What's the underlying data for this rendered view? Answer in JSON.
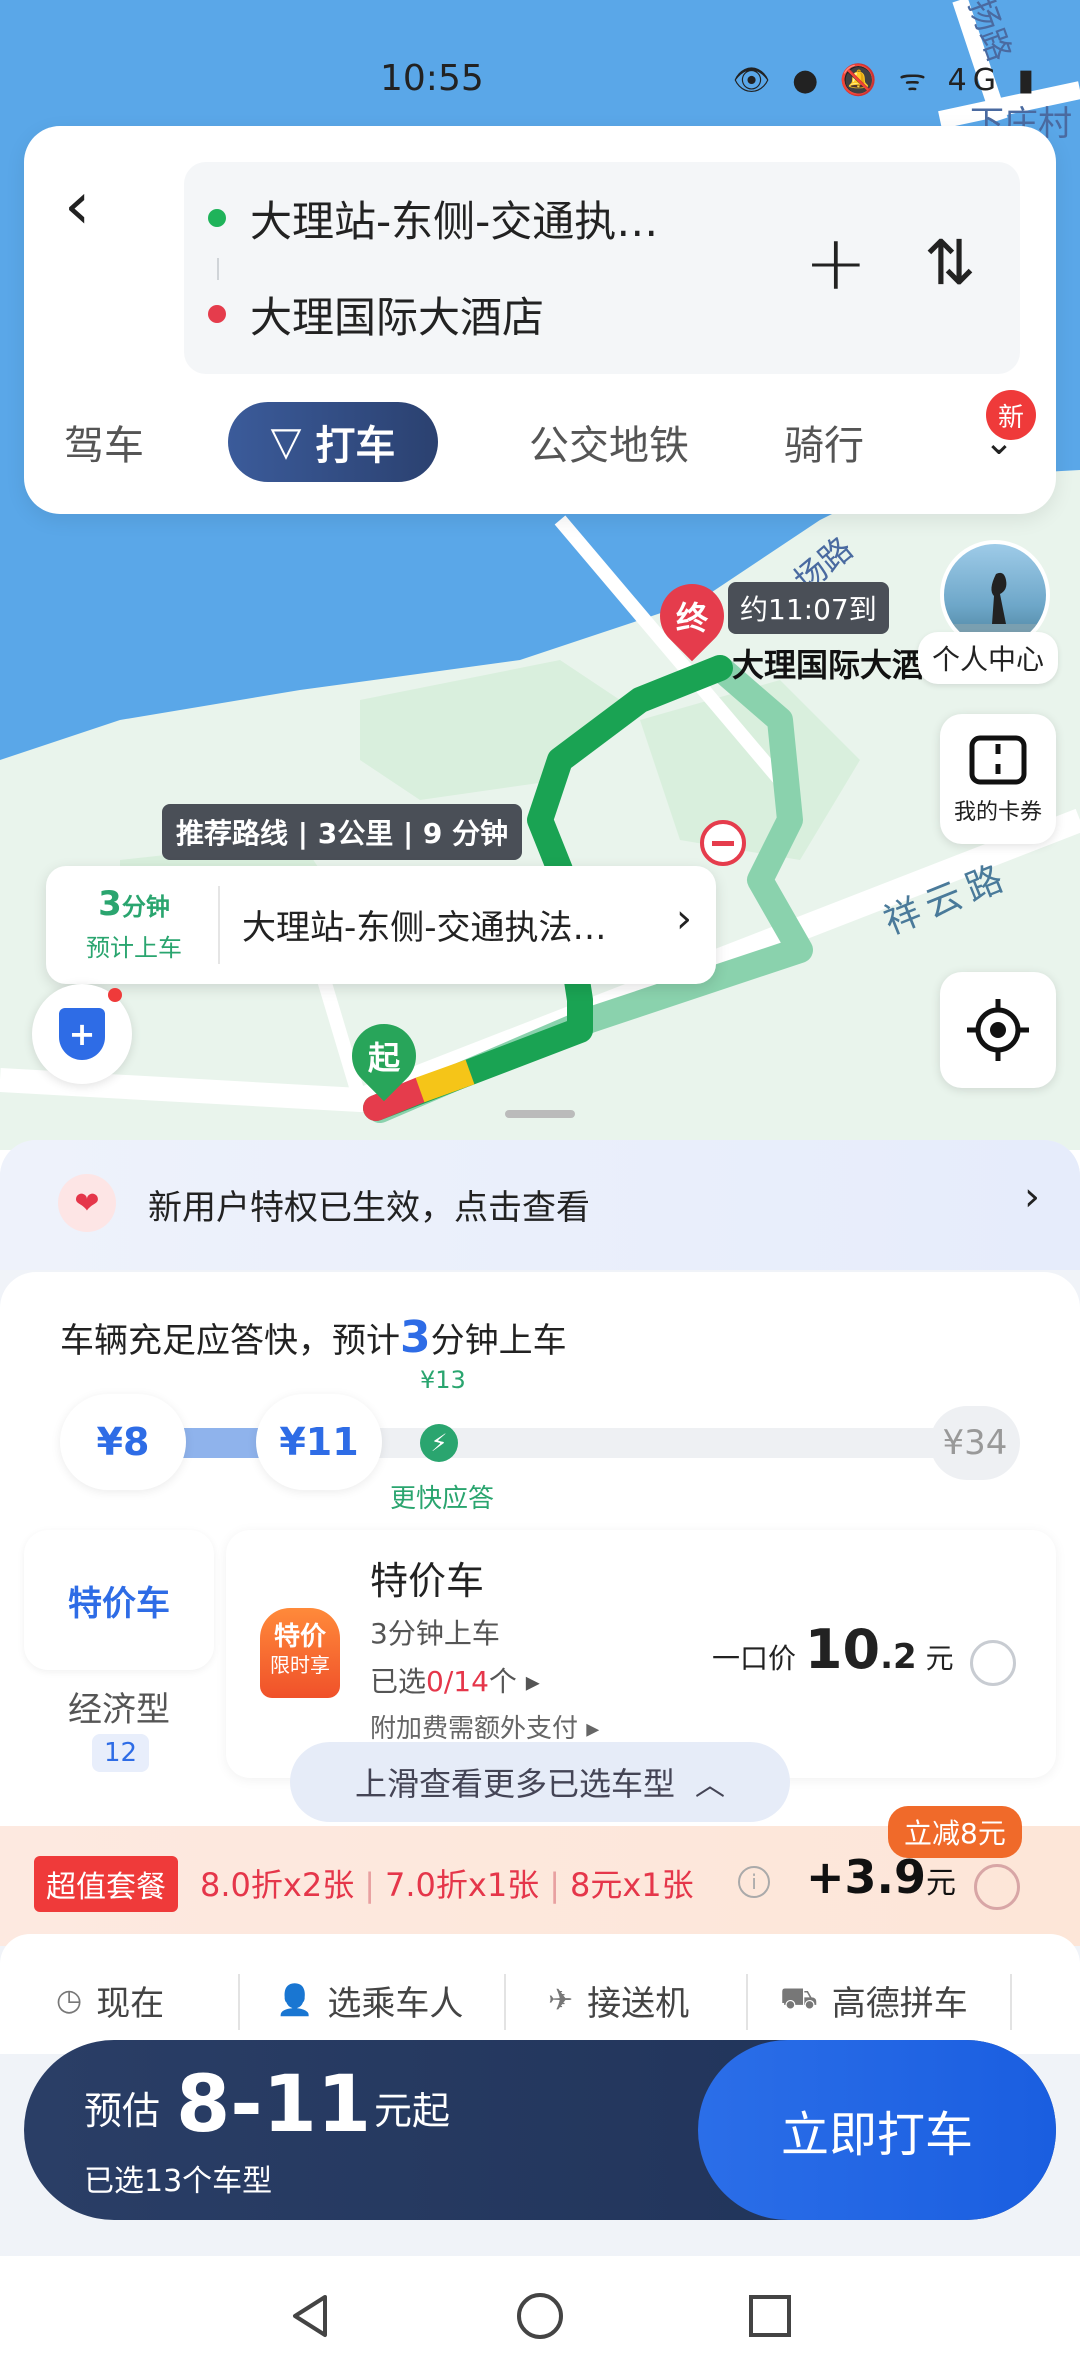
{
  "status": {
    "time": "10:55",
    "icons": "👁 ● 🔕 ᯤ 4G ▮"
  },
  "map": {
    "labels": {
      "xiazhuang": "下庄村",
      "road_top": "扬路",
      "xiangyun_road": "祥云路",
      "road_mid": "场路"
    },
    "eta_tag": "约11:07到",
    "dest_name": "大理国际大酒",
    "end_pin": "终",
    "start_pin": "起",
    "recommend_tag": "推荐路线 | 3公里 | 9 分钟",
    "personal_center": "个人中心",
    "coupons": "我的卡券",
    "pickup": {
      "mins": "3",
      "mins_unit": "分钟",
      "sub": "预计上车",
      "address": "大理站-东侧-交通执法…"
    }
  },
  "route": {
    "start": "大理站-东侧-交通执…",
    "end": "大理国际大酒店",
    "add_icon": "+",
    "swap_icon": "⇅"
  },
  "tabs": [
    {
      "label": "驾车"
    },
    {
      "label": "打车"
    },
    {
      "label": "公交地铁"
    },
    {
      "label": "骑行"
    }
  ],
  "new_badge": "新",
  "promo": {
    "text": "新用户特权已生效，点击查看"
  },
  "supply": {
    "prefix": "车辆充足应答快，预计",
    "num": "3",
    "suffix": "分钟上车"
  },
  "price_slider": {
    "low": "¥8",
    "mid": "¥11",
    "marker_price": "¥13",
    "marker_label": "更快应答",
    "max": "¥34",
    "fill_fraction": 0.25
  },
  "category": {
    "active": "特价车",
    "eco": "经济型",
    "eco_count": "12"
  },
  "car": {
    "logo_top": "特价",
    "logo_bottom": "限时享",
    "name": "特价车",
    "eta": "3分钟上车",
    "selected_prefix": "已选",
    "selected_count": "0/14",
    "selected_suffix": "个 ▸",
    "extra": "附加费需额外支付 ▸",
    "price_label": "一口价",
    "price_int": "10",
    "price_dec": ".2",
    "price_unit": "元"
  },
  "more_hint": "上滑查看更多已选车型",
  "package": {
    "tag": "超值套餐",
    "items": [
      "8.0折x2张",
      "7.0折x1张",
      "8元x1张"
    ],
    "price": "+3.9",
    "unit": "元",
    "badge": "立减8元"
  },
  "options": [
    {
      "label": "现在",
      "icon": "clock-icon"
    },
    {
      "label": "选乘车人",
      "icon": "person-icon"
    },
    {
      "label": "接送机",
      "icon": "plane-icon"
    },
    {
      "label": "高德拼车",
      "icon": "car-icon"
    }
  ],
  "cta": {
    "label": "预估",
    "range": "8-11",
    "unit": "元起",
    "count": "已选13个车型",
    "button": "立即打车"
  },
  "colors": {
    "accent": "#2e6ce6",
    "route_green": "#1aa353",
    "promo_red": "#ef3a3a"
  }
}
